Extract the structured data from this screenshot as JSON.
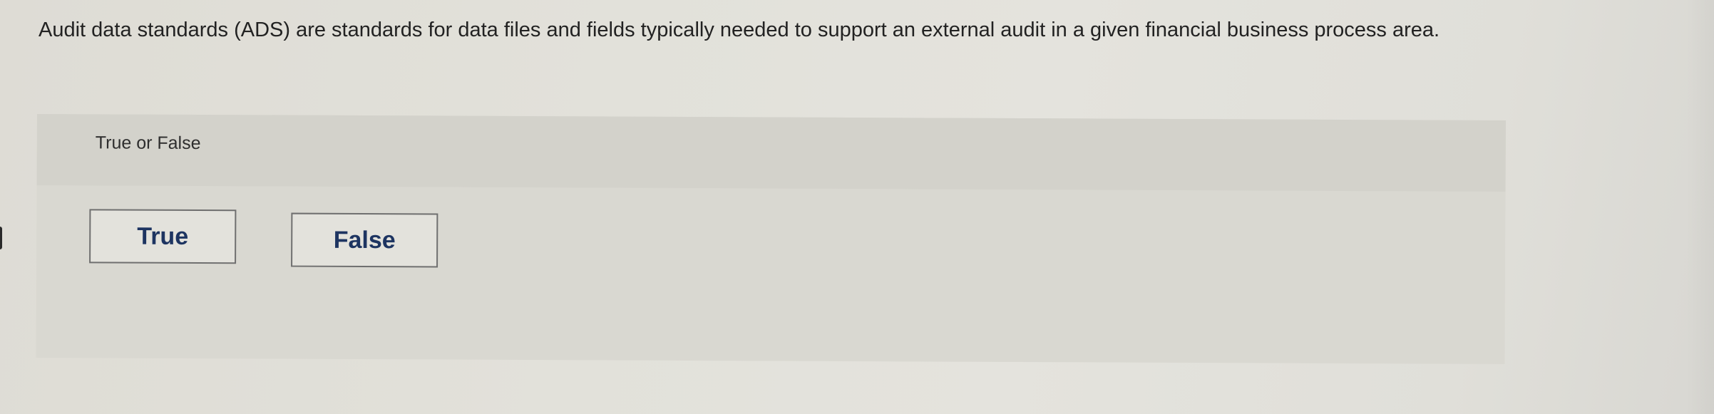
{
  "question": {
    "text": "Audit data standards (ADS) are standards for data files and fields typically needed to support an external audit in a given financial business process area."
  },
  "answer_panel": {
    "label": "True or False",
    "choices": [
      {
        "label": "True"
      },
      {
        "label": "False"
      }
    ]
  },
  "colors": {
    "background": "#e2e1da",
    "panel": "#d9d8d1",
    "button_text": "#1d3461",
    "button_border": "#6f6f6f"
  }
}
